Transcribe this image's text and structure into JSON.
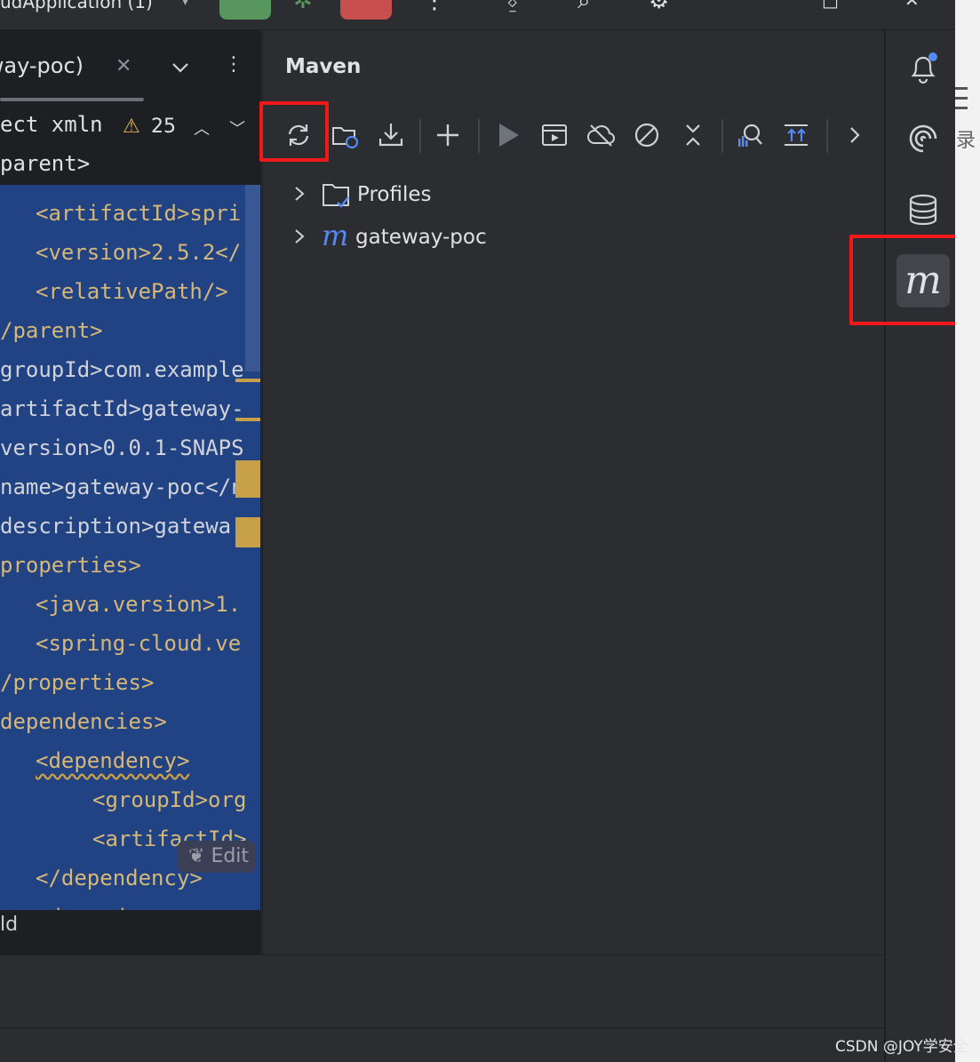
{
  "topbar": {
    "run_config": "udApplication (1)"
  },
  "editor": {
    "tab_label": "eway-poc)",
    "breadcrumb_text": "ect xmln",
    "warning_count": "25",
    "breadcrumb_line2": "parent>",
    "edit_hint": "Edit",
    "status_text": "ld",
    "code_lines": [
      {
        "indent": 1,
        "text": "<artifactId>spri"
      },
      {
        "indent": 1,
        "text": "<version>2.5.2</"
      },
      {
        "indent": 1,
        "text": "<relativePath/>"
      },
      {
        "indent": 0,
        "text": "/parent>"
      },
      {
        "indent": 0,
        "text": "groupId>com.example"
      },
      {
        "indent": 0,
        "text": "artifactId>gateway-"
      },
      {
        "indent": 0,
        "text": "version>0.0.1-SNAPS"
      },
      {
        "indent": 0,
        "text": "name>gateway-poc</n"
      },
      {
        "indent": 0,
        "text": "description>gatewa"
      },
      {
        "indent": 0,
        "text": "properties>"
      },
      {
        "indent": 1,
        "text": "<java.version>1."
      },
      {
        "indent": 1,
        "text": "<spring-cloud.ve"
      },
      {
        "indent": 0,
        "text": "/properties>"
      },
      {
        "indent": 0,
        "text": "dependencies>"
      },
      {
        "indent": 1,
        "text": "<dependency>"
      },
      {
        "indent": 2,
        "text": "<groupId>org"
      },
      {
        "indent": 2,
        "text": "<artifactId>"
      },
      {
        "indent": 1,
        "text": "</dependency>"
      },
      {
        "indent": 1,
        "text": "<dependency>"
      }
    ]
  },
  "maven": {
    "title": "Maven",
    "tree": [
      {
        "label": "Profiles",
        "icon": "folder-profiles-icon"
      },
      {
        "label": "gateway-poc",
        "icon": "maven-module-icon"
      }
    ]
  },
  "colors": {
    "highlight": "#f01818",
    "selection": "#214283",
    "maven_blue": "#548af7",
    "run_green": "#57965c",
    "stop_red": "#c94f4f"
  },
  "watermark": "CSDN @JOY学安全",
  "outside": {
    "char": "录"
  }
}
